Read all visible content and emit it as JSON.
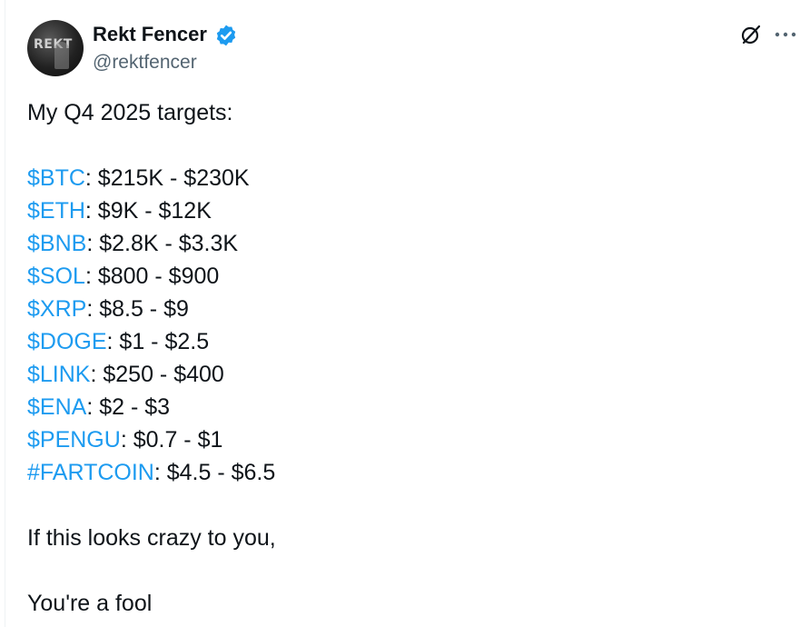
{
  "tweet": {
    "display_name": "Rekt Fencer",
    "handle": "@rektfencer",
    "avatar_text": "REKT",
    "verified": true,
    "intro": "My Q4 2025 targets:",
    "targets": [
      {
        "tag": "$BTC",
        "range": ": $215K - $230K"
      },
      {
        "tag": "$ETH",
        "range": ": $9K - $12K"
      },
      {
        "tag": "$BNB",
        "range": ": $2.8K - $3.3K"
      },
      {
        "tag": "$SOL",
        "range": ": $800 - $900"
      },
      {
        "tag": "$XRP",
        "range": ": $8.5 - $9"
      },
      {
        "tag": "$DOGE",
        "range": ": $1 - $2.5"
      },
      {
        "tag": "$LINK",
        "range": ": $250 - $400"
      },
      {
        "tag": "$ENA",
        "range": ": $2 - $3"
      },
      {
        "tag": "$PENGU",
        "range": ": $0.7 - $1"
      },
      {
        "tag": "#FARTCOIN",
        "range": ": $4.5 - $6.5"
      }
    ],
    "outro_1": "If this looks crazy to you,",
    "outro_2": "You're a fool"
  },
  "icons": {
    "verified": "verified-badge-icon",
    "grok": "grok-icon",
    "more": "more-options-icon"
  },
  "colors": {
    "link": "#1d9bf0",
    "text": "#0f1419",
    "secondary": "#536471"
  }
}
